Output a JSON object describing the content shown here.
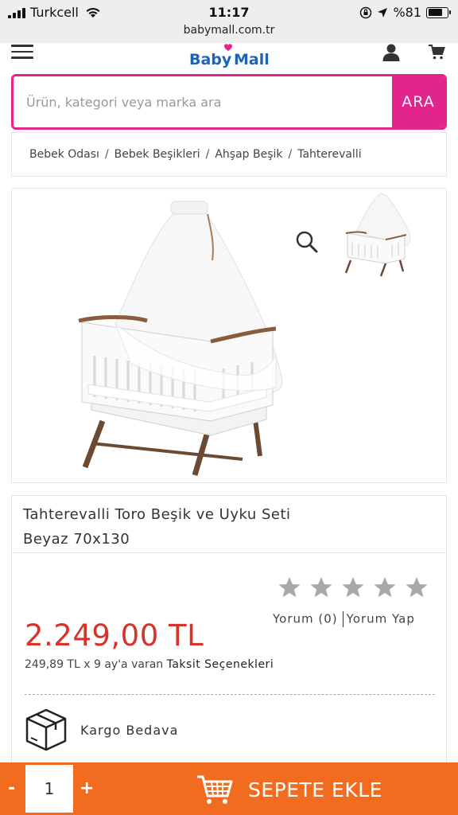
{
  "status_bar": {
    "carrier": "Turkcell",
    "time": "11:17",
    "battery": "%81",
    "battery_level": 0.81,
    "url": "babymall.com.tr"
  },
  "header": {
    "logo_text": "BabyMall",
    "icons": [
      "menu-icon",
      "user-icon",
      "cart-icon"
    ]
  },
  "search": {
    "placeholder": "Ürün, kategori veya marka ara",
    "button": "ARA"
  },
  "breadcrumb": [
    "Bebek Odası",
    "Bebek Beşikleri",
    "Ahşap Beşik",
    "Tahterevalli"
  ],
  "product": {
    "title_line1": "Tahterevalli Toro Beşik ve Uyku Seti",
    "title_line2": "Beyaz 70x130",
    "rating_stars": 5,
    "rating_filled": 0,
    "reviews_label": "Yorum (0)",
    "write_review_label": "Yorum Yap",
    "price": "2.249,00 TL",
    "installment_text": "249,89 TL x 9 ay'a varan",
    "installment_link": "Taksit Seçenekleri",
    "shipping_text": "Kargo Bedava"
  },
  "cart_bar": {
    "minus": "-",
    "quantity": "1",
    "plus": "+",
    "add_label": "SEPETE EKLE"
  },
  "colors": {
    "brand_pink": "#e2258c",
    "price_red": "#d7332b",
    "cart_orange": "#f26c1f",
    "logo_blue": "#1f63b8"
  }
}
